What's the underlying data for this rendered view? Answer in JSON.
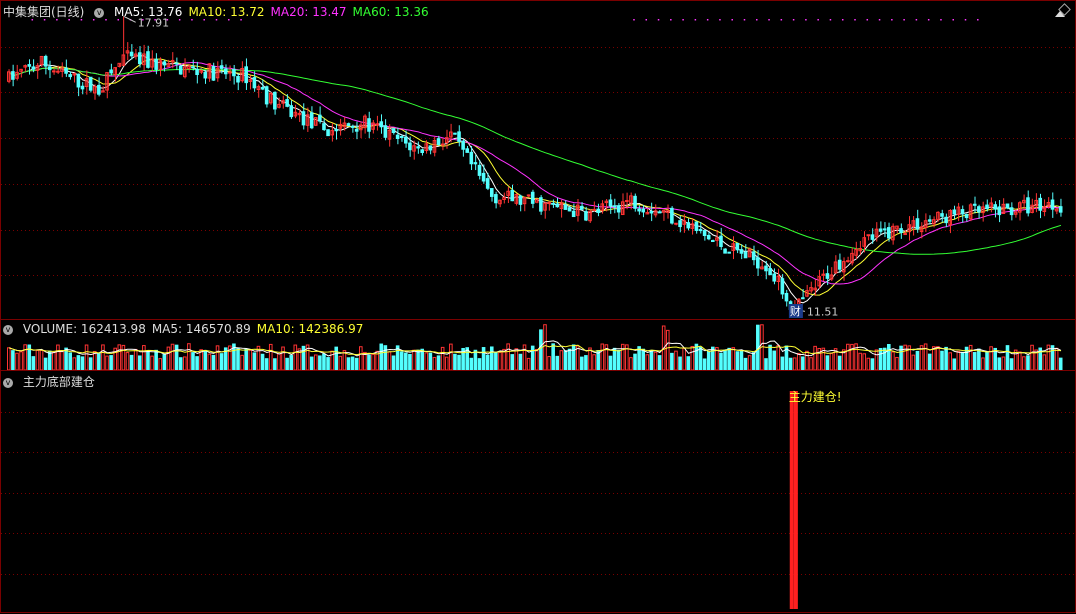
{
  "price_panel": {
    "title": "中集集团(日线)",
    "ma_labels": [
      {
        "text": "MA5: 13.76",
        "color": "#ffffff"
      },
      {
        "text": "MA10: 13.72",
        "color": "#ffff33"
      },
      {
        "text": "MA20: 13.47",
        "color": "#ff33ff"
      },
      {
        "text": "MA60: 13.36",
        "color": "#33ff33"
      }
    ],
    "high_label": "17.91",
    "low_label": "11.51",
    "fin_badge": "财"
  },
  "volume_panel": {
    "labels": [
      {
        "text": "VOLUME: 162413.98",
        "color": "#dddddd"
      },
      {
        "text": "MA5: 146570.89",
        "color": "#dddddd"
      },
      {
        "text": "MA10: 142386.97",
        "color": "#ffff33"
      }
    ]
  },
  "indicator_panel": {
    "title": "主力底部建仓",
    "signal_text": "主力建仓!"
  },
  "colors": {
    "up": "#ff3333",
    "down": "#54ffff",
    "grid": "#7a0000",
    "ma5": "#ffffff",
    "ma10": "#ffff33",
    "ma20": "#ff33ff",
    "ma60": "#33ff33"
  },
  "chart_data": {
    "type": "candlestick",
    "price_range": [
      11.3,
      18.2
    ],
    "high": 17.91,
    "low": 11.51,
    "trend_points": [
      [
        0,
        16.55
      ],
      [
        8,
        16.9
      ],
      [
        14,
        16.6
      ],
      [
        22,
        16.3
      ],
      [
        28,
        17.0
      ],
      [
        40,
        16.8
      ],
      [
        58,
        16.6
      ],
      [
        65,
        16.0
      ],
      [
        78,
        15.4
      ],
      [
        86,
        15.6
      ],
      [
        100,
        15.0
      ],
      [
        108,
        15.3
      ],
      [
        118,
        14.0
      ],
      [
        130,
        13.8
      ],
      [
        142,
        13.6
      ],
      [
        152,
        13.9
      ],
      [
        162,
        13.55
      ],
      [
        172,
        13.0
      ],
      [
        185,
        12.5
      ],
      [
        192,
        11.5
      ],
      [
        200,
        12.3
      ],
      [
        208,
        13.0
      ],
      [
        218,
        13.3
      ],
      [
        232,
        13.6
      ],
      [
        245,
        13.7
      ],
      [
        252,
        13.8
      ],
      [
        256,
        13.8
      ]
    ],
    "signal_indices": [
      191,
      192
    ]
  }
}
